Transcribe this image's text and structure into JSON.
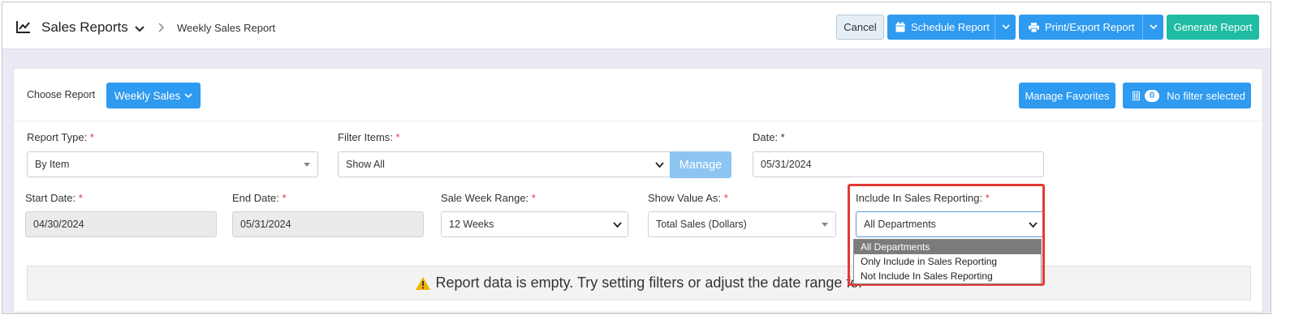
{
  "header": {
    "app_title": "Sales Reports",
    "breadcrumb": "Weekly Sales Report",
    "cancel_label": "Cancel",
    "schedule_label": "Schedule Report",
    "print_label": "Print/Export Report",
    "generate_label": "Generate Report"
  },
  "card": {
    "choose_label": "Choose Report",
    "report_button": "Weekly Sales",
    "manage_favorites": "Manage Favorites",
    "filter_count": "0",
    "filter_status": "No filter selected"
  },
  "form": {
    "report_type": {
      "label": "Report Type:",
      "required": "*",
      "value": "By Item"
    },
    "filter_items": {
      "label": "Filter Items:",
      "required": "*",
      "value": "Show All",
      "manage_label": "Manage"
    },
    "date": {
      "label": "Date: *",
      "value": "05/31/2024"
    },
    "start_date": {
      "label": "Start Date:",
      "required": "*",
      "value": "04/30/2024"
    },
    "end_date": {
      "label": "End Date:",
      "required": "*",
      "value": "05/31/2024"
    },
    "sale_week_range": {
      "label": "Sale Week Range:",
      "required": "*",
      "value": "12 Weeks"
    },
    "show_value_as": {
      "label": "Show Value As:",
      "required": "*",
      "value": "Total Sales (Dollars)"
    },
    "include_in_sales": {
      "label": "Include In Sales Reporting:",
      "required": "*",
      "value": "All Departments",
      "options": [
        "All Departments",
        "Only Include in Sales Reporting",
        "Not Include In Sales Reporting"
      ]
    }
  },
  "empty_message": "Report data is empty. Try setting filters or adjust the date range for",
  "colors": {
    "primary": "#2e9af0",
    "success": "#20bca2",
    "required": "#e0363b",
    "highlight": "#e53935"
  },
  "icons": [
    "chart-line-icon",
    "chevron-down-icon",
    "chevron-right-icon",
    "calendar-icon",
    "printer-icon",
    "filter-icon",
    "warning-icon"
  ]
}
